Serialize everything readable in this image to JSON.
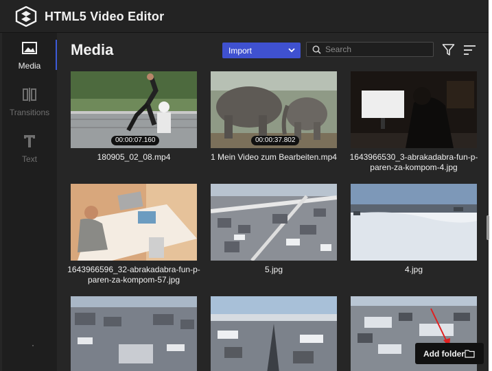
{
  "app": {
    "title": "HTML5 Video Editor"
  },
  "sidebar": {
    "items": [
      {
        "label": "Media",
        "icon": "image-icon",
        "active": true
      },
      {
        "label": "Transitions",
        "icon": "transitions-icon",
        "active": false
      },
      {
        "label": "Text",
        "icon": "text-icon",
        "active": false
      }
    ]
  },
  "media": {
    "title": "Media",
    "import_label": "Import",
    "search_placeholder": "Search",
    "add_folder_label": "Add folder",
    "items": [
      {
        "name": "180905_02_08.mp4",
        "duration": "00:00:07.160",
        "type": "video"
      },
      {
        "name": "1 Mein Video zum Bearbeiten.mp4",
        "duration": "00:00:37.802",
        "type": "video"
      },
      {
        "name": "1643966530_3-abrakadabra-fun-p-paren-za-kompom-4.jpg",
        "type": "image"
      },
      {
        "name": "1643966596_32-abrakadabra-fun-p-paren-za-kompom-57.jpg",
        "type": "image"
      },
      {
        "name": "5.jpg",
        "type": "image"
      },
      {
        "name": "4.jpg",
        "type": "image"
      },
      {
        "name": "",
        "type": "image"
      },
      {
        "name": "",
        "type": "image"
      },
      {
        "name": "",
        "type": "image"
      }
    ]
  },
  "colors": {
    "accent": "#3f51d0",
    "background": "#262626",
    "sidebar": "#1e1e1e",
    "annotation_arrow": "#e02020"
  }
}
